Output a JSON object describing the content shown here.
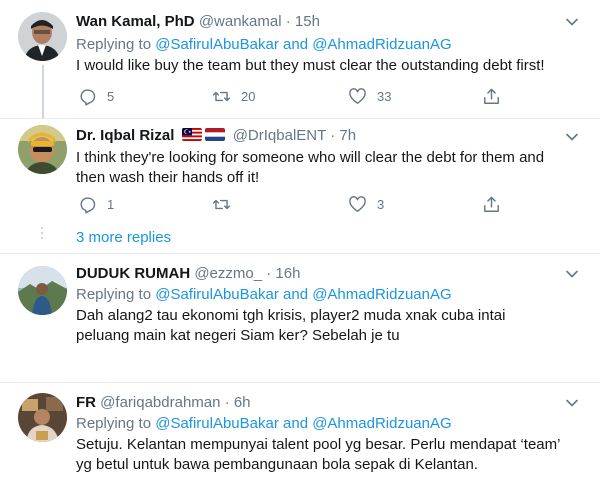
{
  "tweets": [
    {
      "name": "Wan Kamal, PhD",
      "handle": "@wankamal",
      "dot": "·",
      "time": "15h",
      "replying_prefix": "Replying to",
      "replying_to": "@SafirulAbuBakar and @AhmadRidzuanAG",
      "text": "I would like buy the team but they must clear the outstanding debt first!",
      "replies": "5",
      "retweets": "20",
      "likes": "33"
    },
    {
      "name": "Dr. Iqbal Rizal",
      "handle": "@DrIqbalENT",
      "dot": "·",
      "time": "7h",
      "text": "I think they're looking for someone who will clear the debt for them and then wash their hands off it!",
      "replies": "1",
      "retweets": "",
      "likes": "3"
    },
    {
      "name": "DUDUK RUMAH",
      "handle": "@ezzmo_",
      "dot": "·",
      "time": "16h",
      "replying_prefix": "Replying to",
      "replying_to": "@SafirulAbuBakar and @AhmadRidzuanAG",
      "text": "Dah alang2 tau ekonomi tgh krisis, player2 muda xnak cuba intai peluang main kat negeri Siam ker? Sebelah je tu"
    },
    {
      "name": "FR",
      "handle": "@fariqabdrahman",
      "dot": "·",
      "time": "6h",
      "replying_prefix": "Replying to",
      "replying_to": "@SafirulAbuBakar and @AhmadRidzuanAG",
      "text": "Setuju. Kelantan mempunyai talent pool yg besar. Perlu mendapat ‘team’ yg betul untuk bawa pembangunaan bola sepak di Kelantan."
    }
  ],
  "more_replies": "3 more replies",
  "colors": {
    "link": "#1b95e0",
    "muted": "#657786",
    "divider": "#e6ecf0"
  },
  "icons": [
    "reply-icon",
    "retweet-icon",
    "like-icon",
    "share-icon",
    "chevron-down-icon",
    "flag-malaysia-icon",
    "flag-netherlands-icon"
  ]
}
